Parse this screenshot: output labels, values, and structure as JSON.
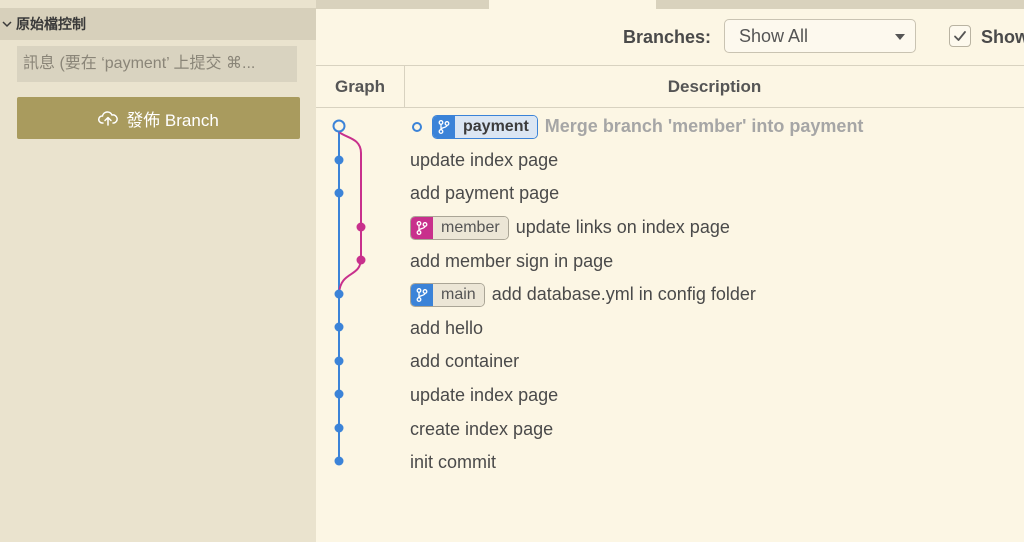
{
  "sidebar": {
    "section_title": "原始檔控制",
    "commit_placeholder": "訊息 (要在 ‘payment’ 上提交 ⌘...",
    "publish_label": "發佈 Branch"
  },
  "toolbar": {
    "branches_label": "Branches:",
    "branches_value": "Show All",
    "show_label": "Show",
    "show_checked": true
  },
  "columns": {
    "graph": "Graph",
    "description": "Description"
  },
  "colors": {
    "main_line": "#3b83d8",
    "member_line": "#c8308c",
    "accent": "#a99b5e"
  },
  "commits": [
    {
      "message": "Merge branch 'member' into payment",
      "branch": "payment",
      "head": true
    },
    {
      "message": "update index page"
    },
    {
      "message": "add payment page"
    },
    {
      "message": "update links on index page",
      "branch": "member"
    },
    {
      "message": "add member sign in page"
    },
    {
      "message": "add database.yml in config folder",
      "branch": "main"
    },
    {
      "message": "add hello"
    },
    {
      "message": "add container"
    },
    {
      "message": "update index page"
    },
    {
      "message": "create index page"
    },
    {
      "message": "init commit"
    }
  ]
}
